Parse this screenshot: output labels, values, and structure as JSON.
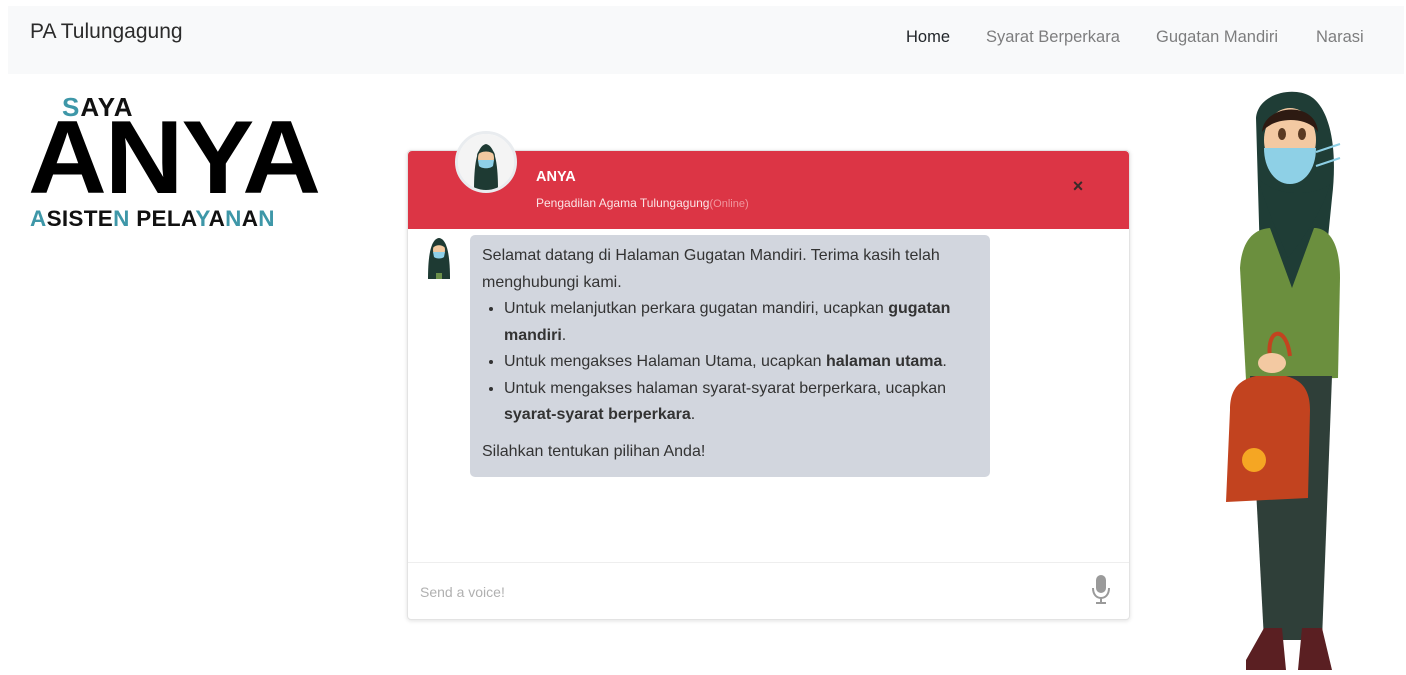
{
  "navbar": {
    "brand": "PA Tulungagung",
    "links": [
      {
        "label": "Home",
        "active": true
      },
      {
        "label": "Syarat Berperkara",
        "active": false
      },
      {
        "label": "Gugatan Mandiri",
        "active": false
      },
      {
        "label": "Narasi",
        "active": false
      }
    ]
  },
  "logo": {
    "saya_accent": "S",
    "saya_rest": "AYA",
    "anya": "ANYA",
    "sub": [
      {
        "text": "A",
        "accent": true
      },
      {
        "text": "SISTE",
        "accent": false
      },
      {
        "text": "N",
        "accent": true
      },
      {
        "text": " PELA",
        "accent": false
      },
      {
        "text": "Y",
        "accent": true
      },
      {
        "text": "A",
        "accent": false
      },
      {
        "text": "N",
        "accent": true
      },
      {
        "text": "A",
        "accent": false
      },
      {
        "text": "N",
        "accent": true
      }
    ]
  },
  "chat": {
    "header": {
      "name": "ANYA",
      "org": "Pengadilan Agama Tulungagung",
      "status": "(Online)",
      "close_icon": "×"
    },
    "message": {
      "intro": "Selamat datang di Halaman Gugatan Mandiri. Terima kasih telah menghubungi kami.",
      "items": [
        {
          "before": "Untuk melanjutkan perkara gugatan mandiri, ucapkan ",
          "bold": "gugatan mandiri",
          "after": "."
        },
        {
          "before": "Untuk mengakses Halaman Utama, ucapkan ",
          "bold": "halaman utama",
          "after": "."
        },
        {
          "before": "Untuk mengakses halaman syarat-syarat berperkara, ucapkan ",
          "bold": "syarat-syarat berperkara",
          "after": "."
        }
      ],
      "closing": "Silahkan tentukan pilihan Anda!"
    },
    "footer": {
      "placeholder": "Send a voice!"
    }
  },
  "colors": {
    "header_red": "#dc3545",
    "bubble_gray": "#d2d6de",
    "logo_accent": "#3e97a8",
    "navbar_bg": "#f8f9fa"
  },
  "icons": {
    "close": "close-icon",
    "mic": "microphone-icon"
  }
}
